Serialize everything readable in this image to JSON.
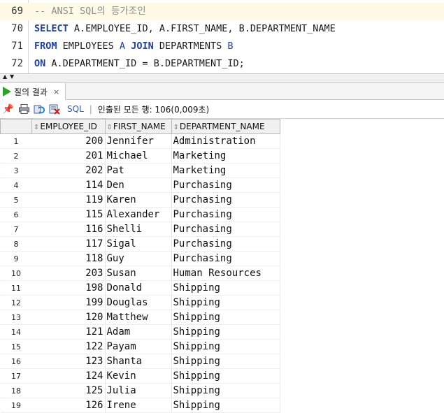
{
  "editor": {
    "lines": [
      {
        "num": "69",
        "parts": [
          {
            "t": "-- ANSI SQL의 등가조인",
            "c": "cmt"
          }
        ]
      },
      {
        "num": "70",
        "parts": [
          {
            "t": "SELECT",
            "c": "kw"
          },
          {
            "t": " A.EMPLOYEE_ID, A.FIRST_NAME, B.DEPARTMENT_NAME",
            "c": ""
          }
        ]
      },
      {
        "num": "71",
        "parts": [
          {
            "t": "FROM",
            "c": "kw"
          },
          {
            "t": " EMPLOYEES ",
            "c": ""
          },
          {
            "t": "A",
            "c": "al"
          },
          {
            "t": " ",
            "c": ""
          },
          {
            "t": "JOIN",
            "c": "kw"
          },
          {
            "t": " DEPARTMENTS ",
            "c": ""
          },
          {
            "t": "B",
            "c": "al"
          }
        ]
      },
      {
        "num": "72",
        "parts": [
          {
            "t": "ON",
            "c": "kw"
          },
          {
            "t": " A.DEPARTMENT_ID = B.DEPARTMENT_ID;",
            "c": ""
          }
        ]
      }
    ]
  },
  "result_tab": {
    "label": "질의 결과",
    "close": "×"
  },
  "toolbar": {
    "sql_label": "SQL",
    "separator": "|",
    "status": "인출된 모든 행: 106(0,009초)"
  },
  "grid": {
    "columns": [
      "EMPLOYEE_ID",
      "FIRST_NAME",
      "DEPARTMENT_NAME"
    ],
    "rows": [
      [
        "1",
        "200",
        "Jennifer",
        "Administration"
      ],
      [
        "2",
        "201",
        "Michael",
        "Marketing"
      ],
      [
        "3",
        "202",
        "Pat",
        "Marketing"
      ],
      [
        "4",
        "114",
        "Den",
        "Purchasing"
      ],
      [
        "5",
        "119",
        "Karen",
        "Purchasing"
      ],
      [
        "6",
        "115",
        "Alexander",
        "Purchasing"
      ],
      [
        "7",
        "116",
        "Shelli",
        "Purchasing"
      ],
      [
        "8",
        "117",
        "Sigal",
        "Purchasing"
      ],
      [
        "9",
        "118",
        "Guy",
        "Purchasing"
      ],
      [
        "10",
        "203",
        "Susan",
        "Human Resources"
      ],
      [
        "11",
        "198",
        "Donald",
        "Shipping"
      ],
      [
        "12",
        "199",
        "Douglas",
        "Shipping"
      ],
      [
        "13",
        "120",
        "Matthew",
        "Shipping"
      ],
      [
        "14",
        "121",
        "Adam",
        "Shipping"
      ],
      [
        "15",
        "122",
        "Payam",
        "Shipping"
      ],
      [
        "16",
        "123",
        "Shanta",
        "Shipping"
      ],
      [
        "17",
        "124",
        "Kevin",
        "Shipping"
      ],
      [
        "18",
        "125",
        "Julia",
        "Shipping"
      ],
      [
        "19",
        "126",
        "Irene",
        "Shipping"
      ]
    ]
  },
  "colors": {
    "keyword": "#1f3fa5",
    "comment": "#8c8c8c",
    "run_icon": "#2aa32a",
    "current_line": "#fffae6"
  }
}
